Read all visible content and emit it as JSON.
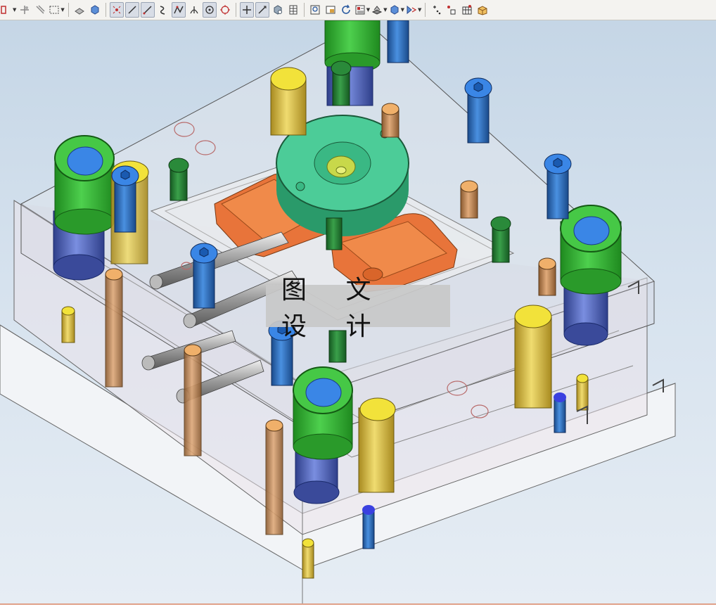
{
  "toolbar": {
    "groups": [
      [
        "select-dropdown",
        "snap-point-icon",
        "snap-lines-icon",
        "box-select-icon",
        "box-dropdown"
      ],
      [
        "block-solid-icon",
        "cube-view-icon"
      ],
      [
        "point-on-object-icon",
        "line-tool-icon",
        "line-segment-icon",
        "arc-tool-icon",
        "polyline-icon",
        "intersection-icon",
        "center-point-icon",
        "circle-point-icon"
      ],
      [
        "cross-point-icon",
        "direction-line-icon",
        "shaded-cube-icon",
        "table-grid-icon"
      ],
      [
        "zoom-fit-icon",
        "zoom-window-icon",
        "rotate-icon",
        "view-orient-icon",
        "render-mode-icon",
        "shaded-solid-icon",
        "visibility-icon"
      ],
      [
        "add-point-icon",
        "point-set-icon",
        "grid-snap-icon",
        "layer-box-icon"
      ]
    ]
  },
  "viewport": {
    "background_top": "#c5d6e6",
    "background_bottom": "#e6edf4"
  },
  "watermark": {
    "text": "图 文 设 计"
  },
  "colors": {
    "guide_green": "#2fb42f",
    "bushing_blue": "#5a72c8",
    "cap_blue": "#3a86e6",
    "screw_blue": "#2a6cc0",
    "pin_yellow": "#e0c84a",
    "pin_copper": "#c08a5a",
    "sprue_teal": "#3cc28a",
    "part_orange": "#e8743a",
    "screw_green": "#2a8a3a"
  }
}
